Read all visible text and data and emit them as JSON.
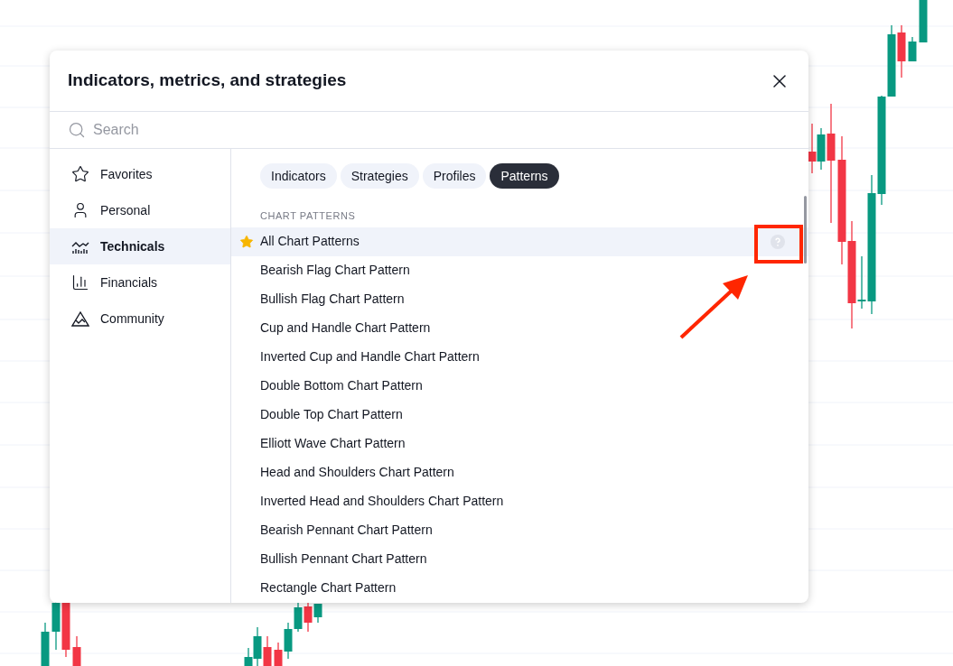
{
  "dialog": {
    "title": "Indicators, metrics, and strategies"
  },
  "search": {
    "placeholder": "Search"
  },
  "sidebar": {
    "items": [
      {
        "label": "Favorites",
        "kind": "star",
        "selected": false
      },
      {
        "label": "Personal",
        "kind": "person",
        "selected": false
      },
      {
        "label": "Technicals",
        "kind": "technicals",
        "selected": true
      },
      {
        "label": "Financials",
        "kind": "financials",
        "selected": false
      },
      {
        "label": "Community",
        "kind": "community",
        "selected": false
      }
    ]
  },
  "tabs": [
    {
      "label": "Indicators",
      "selected": false
    },
    {
      "label": "Strategies",
      "selected": false
    },
    {
      "label": "Profiles",
      "selected": false
    },
    {
      "label": "Patterns",
      "selected": true
    }
  ],
  "section_title": "CHART PATTERNS",
  "items": [
    {
      "label": "All Chart Patterns",
      "favorite": true,
      "selected": true
    },
    {
      "label": "Bearish Flag Chart Pattern",
      "favorite": false,
      "selected": false
    },
    {
      "label": "Bullish Flag Chart Pattern",
      "favorite": false,
      "selected": false
    },
    {
      "label": "Cup and Handle Chart Pattern",
      "favorite": false,
      "selected": false
    },
    {
      "label": "Inverted Cup and Handle Chart Pattern",
      "favorite": false,
      "selected": false
    },
    {
      "label": "Double Bottom Chart Pattern",
      "favorite": false,
      "selected": false
    },
    {
      "label": "Double Top Chart Pattern",
      "favorite": false,
      "selected": false
    },
    {
      "label": "Elliott Wave Chart Pattern",
      "favorite": false,
      "selected": false
    },
    {
      "label": "Head and Shoulders Chart Pattern",
      "favorite": false,
      "selected": false
    },
    {
      "label": "Inverted Head and Shoulders Chart Pattern",
      "favorite": false,
      "selected": false
    },
    {
      "label": "Bearish Pennant Chart Pattern",
      "favorite": false,
      "selected": false
    },
    {
      "label": "Bullish Pennant Chart Pattern",
      "favorite": false,
      "selected": false
    },
    {
      "label": "Rectangle Chart Pattern",
      "favorite": false,
      "selected": false
    }
  ]
}
